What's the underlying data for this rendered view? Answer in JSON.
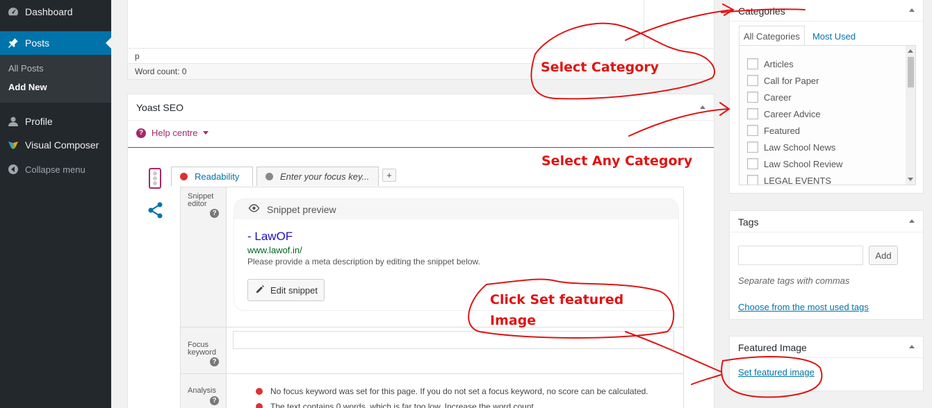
{
  "sidebar": {
    "dashboard": "Dashboard",
    "posts": "Posts",
    "all_posts": "All Posts",
    "add_new": "Add New",
    "profile": "Profile",
    "visual_composer": "Visual Composer",
    "collapse": "Collapse menu"
  },
  "editor": {
    "path": "p",
    "word_count": "Word count: 0"
  },
  "yoast": {
    "title": "Yoast SEO",
    "help": "Help centre",
    "tab_readability": "Readability",
    "tab_focus": "Enter your focus key...",
    "tab_add": "+",
    "label_snippet_1": "Snippet",
    "label_snippet_2": "editor",
    "label_focus_1": "Focus",
    "label_focus_2": "keyword",
    "label_analysis": "Analysis",
    "snippet_preview": "Snippet preview",
    "snippet_title": "- LawOF",
    "snippet_url": "www.lawof.in/",
    "snippet_desc": "Please provide a meta description by editing the snippet below.",
    "edit_snippet": "Edit snippet",
    "analysis": [
      "No focus keyword was set for this page. If you do not set a focus keyword, no score can be calculated.",
      "The text contains 0 words, which is far too low. Increase the word count."
    ]
  },
  "categories": {
    "title": "Categories",
    "tab_all": "All Categories",
    "tab_most": "Most Used",
    "items": [
      "Articles",
      "Call for Paper",
      "Career",
      "Career Advice",
      "Featured",
      "Law School News",
      "Law School Review",
      "LEGAL EVENTS"
    ]
  },
  "tags": {
    "title": "Tags",
    "add": "Add",
    "hint": "Separate tags with commas",
    "choose": "Choose from the most used tags"
  },
  "featured": {
    "title": "Featured Image",
    "link": "Set featured image"
  },
  "annotations": {
    "select_category": "Select Category",
    "select_any": "Select Any Category",
    "click_set_1": "Click Set featured",
    "click_set_2": "Image"
  },
  "colors": {
    "wp_blue": "#0073aa",
    "yoast_purple": "#a4286a",
    "annotation_red": "#e01414",
    "bad_red": "#dc3232"
  }
}
